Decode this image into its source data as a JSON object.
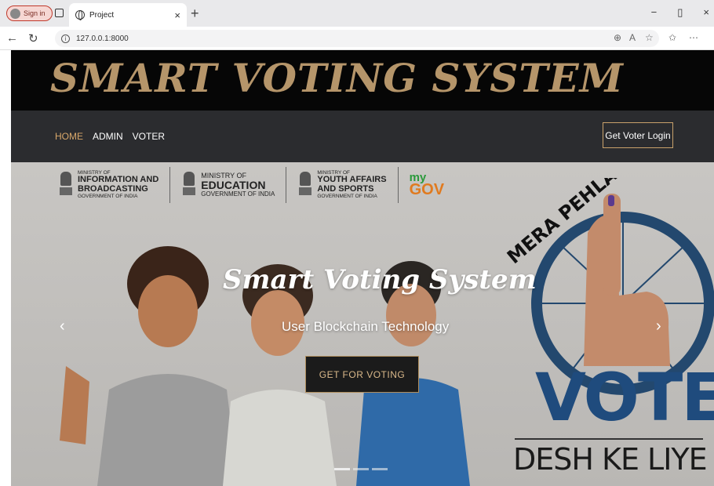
{
  "browser": {
    "signin_label": "Sign in",
    "tab_title": "Project",
    "url": "127.0.0.1:8000"
  },
  "site": {
    "title": "SMART VOTING SYSTEM",
    "nav": [
      "HOME",
      "ADMIN",
      "VOTER"
    ],
    "login_button": "Get Voter Login"
  },
  "logos": [
    {
      "small": "MINISTRY OF",
      "big": [
        "INFORMATION AND",
        "BROADCASTING"
      ],
      "foot": "GOVERNMENT OF INDIA"
    },
    {
      "small": "MINISTRY OF",
      "big": [
        "EDUCATION"
      ],
      "foot": "GOVERNMENT OF INDIA"
    },
    {
      "small": "MINISTRY OF",
      "big": [
        "YOUTH AFFAIRS",
        "AND SPORTS"
      ],
      "foot": "GOVERNMENT OF INDIA"
    }
  ],
  "mygov": {
    "my": "my",
    "gov": "GOV"
  },
  "hero": {
    "title": "Smart Voting System",
    "subtitle": "User Blockchain Technology",
    "cta": "GET FOR VOTING",
    "prev": "‹",
    "next": "›",
    "slides": 3,
    "active_slide": 1
  },
  "campaign": {
    "arc_text": "MERA PEHLA",
    "vote": "VOTE",
    "tagline": "DESH KE LIYE"
  },
  "colors": {
    "title_gold": "#b5956a",
    "navbar": "#2b2c2f",
    "vote_blue": "#1f4b7d"
  }
}
